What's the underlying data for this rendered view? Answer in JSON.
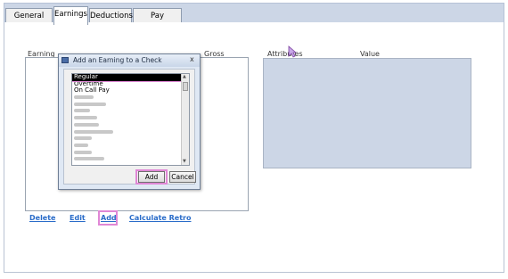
{
  "tabs": [
    {
      "label": "General Info"
    },
    {
      "label": "Earnings"
    },
    {
      "label": "Deductions"
    },
    {
      "label": "Pay Allocation"
    }
  ],
  "earnings_grid": {
    "headers": [
      "Earning",
      "Gross"
    ]
  },
  "attributes_panel": {
    "headers": [
      "Attributes",
      "Value"
    ]
  },
  "actions": {
    "delete": "Delete",
    "edit": "Edit",
    "add": "Add",
    "calculate_retro": "Calculate Retro"
  },
  "dialog": {
    "title": "Add an Earning to a Check",
    "close": "x",
    "items": [
      "Regular",
      "Overtime",
      "On Call Pay"
    ],
    "add_button": "Add",
    "cancel_button": "Cancel"
  },
  "colors": {
    "accent_link": "#2a6cc9",
    "highlight": "#e087d6",
    "panel": "#ccd6e6"
  }
}
